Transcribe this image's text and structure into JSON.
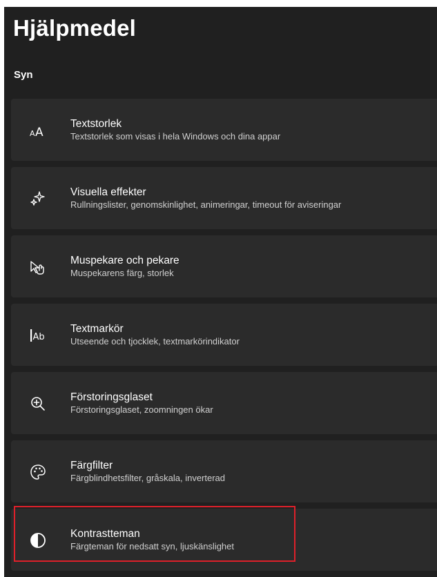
{
  "page": {
    "title": "Hjälpmedel",
    "section": "Syn"
  },
  "items": [
    {
      "title": "Textstorlek",
      "subtitle": "Textstorlek som visas i hela Windows och dina appar",
      "icon": "text-size-icon"
    },
    {
      "title": "Visuella effekter",
      "subtitle": "Rullningslister, genomskinlighet, animeringar, timeout för aviseringar",
      "icon": "sparkle-icon"
    },
    {
      "title": "Muspekare och pekare",
      "subtitle": "Muspekarens färg, storlek",
      "icon": "mouse-pointer-icon"
    },
    {
      "title": "Textmarkör",
      "subtitle": "Utseende och tjocklek, textmarkörindikator",
      "icon": "text-cursor-icon"
    },
    {
      "title": "Förstoringsglaset",
      "subtitle": "Förstoringsglaset, zoomningen ökar",
      "icon": "magnifier-icon"
    },
    {
      "title": "Färgfilter",
      "subtitle": "Färgblindhetsfilter, gråskala, inverterad",
      "icon": "palette-icon"
    },
    {
      "title": "Kontrastteman",
      "subtitle": "Färgteman för nedsatt syn, ljuskänslighet",
      "icon": "contrast-icon"
    }
  ],
  "highlight": {
    "target": "Kontrastteman",
    "color": "#e0202a"
  },
  "colors": {
    "background": "#202020",
    "card": "#2b2b2b",
    "text": "#ffffff",
    "subtext": "#d0d0d0"
  }
}
